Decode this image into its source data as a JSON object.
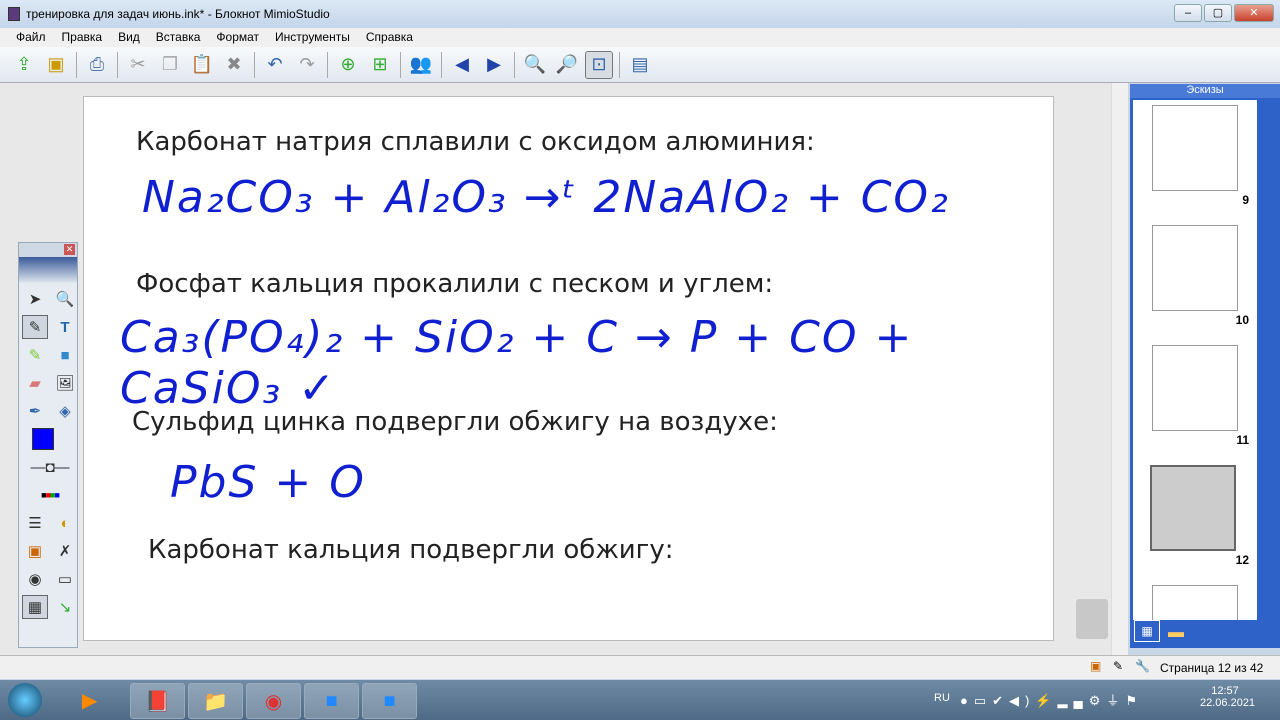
{
  "window": {
    "title": "тренировка для задач июнь.ink* - Блокнот MimioStudio"
  },
  "menu": [
    "Файл",
    "Правка",
    "Вид",
    "Вставка",
    "Формат",
    "Инструменты",
    "Справка"
  ],
  "page": {
    "lines": [
      "Карбонат натрия сплавили с оксидом алюминия:",
      "Фосфат кальция прокалили с песком и углем:",
      "Сульфид цинка подвергли обжигу на воздухе:",
      "Карбонат кальция подвергли обжигу:"
    ],
    "handwriting": {
      "eq1": "Na₂CO₃ + Al₂O₃ →ᵗ 2NaAlO₂ + CO₂",
      "eq2": "Ca₃(PO₄)₂ + SiO₂ + C → P + CO + CaSiO₃ ✓",
      "eq3": "PbS + O"
    }
  },
  "thumbnails": {
    "title": "Эскизы",
    "pages": [
      "9",
      "10",
      "11",
      "12"
    ],
    "selected": "12"
  },
  "status": {
    "page": "Страница 12 из 42"
  },
  "taskbar": {
    "lang": "RU",
    "time": "12:57",
    "date": "22.06.2021"
  },
  "colors": {
    "ink": "#1020d0",
    "panel": "#2f62c8"
  }
}
